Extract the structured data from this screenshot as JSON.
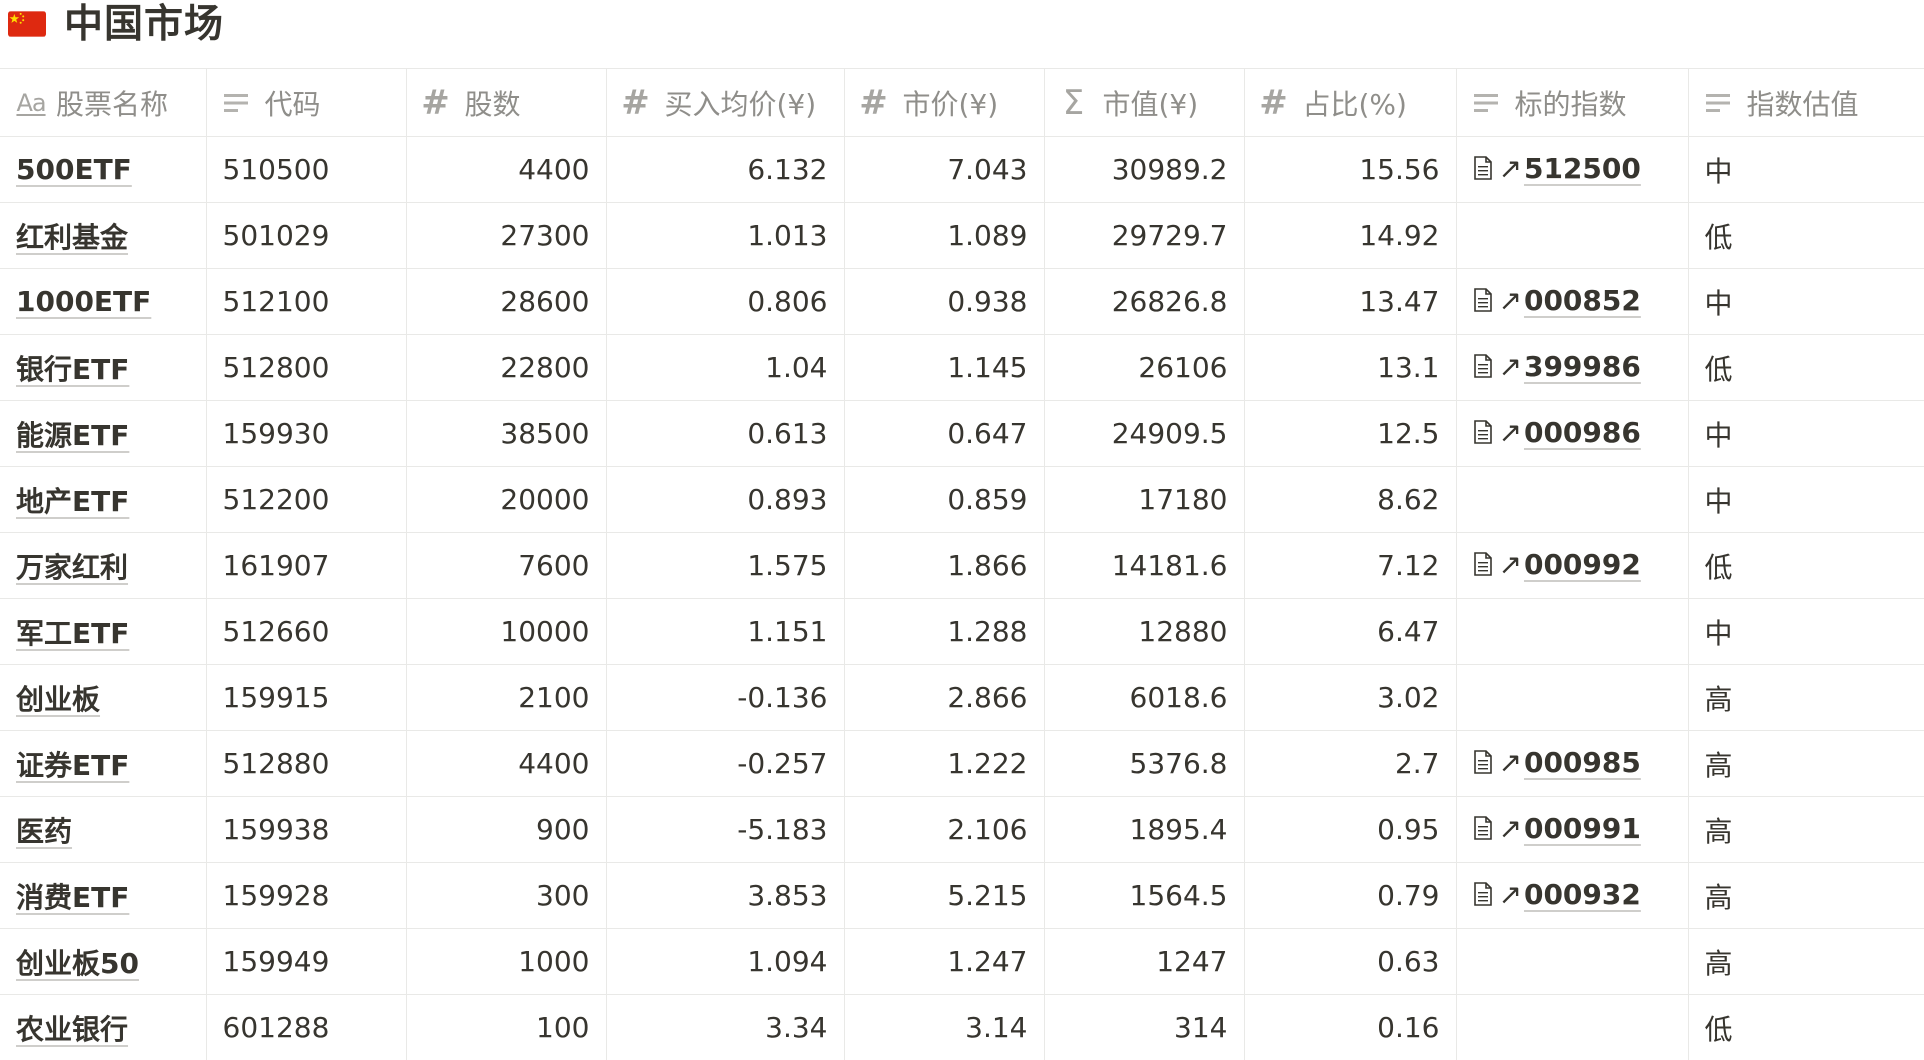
{
  "page": {
    "title": "中国市场",
    "flag_icon": "china-flag-icon",
    "colors": {
      "flag_red": "#de2910",
      "flag_yellow": "#ffde00",
      "text": "#37352f",
      "muted": "#8f8e8a",
      "border": "#e9e9e7"
    }
  },
  "columns": [
    {
      "key": "name",
      "label": "股票名称",
      "icon": "title-aa-icon"
    },
    {
      "key": "code",
      "label": "代码",
      "icon": "text-lines-icon"
    },
    {
      "key": "shares",
      "label": "股数",
      "icon": "number-hash-icon"
    },
    {
      "key": "cost",
      "label": "买入均价(¥)",
      "icon": "number-hash-icon"
    },
    {
      "key": "price",
      "label": "市价(¥)",
      "icon": "number-hash-icon"
    },
    {
      "key": "market_value",
      "label": "市值(¥)",
      "icon": "formula-sigma-icon"
    },
    {
      "key": "ratio",
      "label": "占比(%)",
      "icon": "number-hash-icon"
    },
    {
      "key": "index",
      "label": "标的指数",
      "icon": "text-lines-icon"
    },
    {
      "key": "valuation",
      "label": "指数估值",
      "icon": "text-lines-icon"
    }
  ],
  "rows": [
    {
      "name": "500ETF",
      "code": "510500",
      "shares": "4400",
      "cost": "6.132",
      "price": "7.043",
      "market_value": "30989.2",
      "ratio": "15.56",
      "index": "512500",
      "valuation": "中"
    },
    {
      "name": "红利基金",
      "code": "501029",
      "shares": "27300",
      "cost": "1.013",
      "price": "1.089",
      "market_value": "29729.7",
      "ratio": "14.92",
      "index": "",
      "valuation": "低"
    },
    {
      "name": "1000ETF",
      "code": "512100",
      "shares": "28600",
      "cost": "0.806",
      "price": "0.938",
      "market_value": "26826.8",
      "ratio": "13.47",
      "index": "000852",
      "valuation": "中"
    },
    {
      "name": "银行ETF",
      "code": "512800",
      "shares": "22800",
      "cost": "1.04",
      "price": "1.145",
      "market_value": "26106",
      "ratio": "13.1",
      "index": "399986",
      "valuation": "低"
    },
    {
      "name": "能源ETF",
      "code": "159930",
      "shares": "38500",
      "cost": "0.613",
      "price": "0.647",
      "market_value": "24909.5",
      "ratio": "12.5",
      "index": "000986",
      "valuation": "中"
    },
    {
      "name": "地产ETF",
      "code": "512200",
      "shares": "20000",
      "cost": "0.893",
      "price": "0.859",
      "market_value": "17180",
      "ratio": "8.62",
      "index": "",
      "valuation": "中"
    },
    {
      "name": "万家红利",
      "code": "161907",
      "shares": "7600",
      "cost": "1.575",
      "price": "1.866",
      "market_value": "14181.6",
      "ratio": "7.12",
      "index": "000992",
      "valuation": "低"
    },
    {
      "name": "军工ETF",
      "code": "512660",
      "shares": "10000",
      "cost": "1.151",
      "price": "1.288",
      "market_value": "12880",
      "ratio": "6.47",
      "index": "",
      "valuation": "中"
    },
    {
      "name": "创业板",
      "code": "159915",
      "shares": "2100",
      "cost": "-0.136",
      "price": "2.866",
      "market_value": "6018.6",
      "ratio": "3.02",
      "index": "",
      "valuation": "高"
    },
    {
      "name": "证券ETF",
      "code": "512880",
      "shares": "4400",
      "cost": "-0.257",
      "price": "1.222",
      "market_value": "5376.8",
      "ratio": "2.7",
      "index": "000985",
      "valuation": "高"
    },
    {
      "name": "医药",
      "code": "159938",
      "shares": "900",
      "cost": "-5.183",
      "price": "2.106",
      "market_value": "1895.4",
      "ratio": "0.95",
      "index": "000991",
      "valuation": "高"
    },
    {
      "name": "消费ETF",
      "code": "159928",
      "shares": "300",
      "cost": "3.853",
      "price": "5.215",
      "market_value": "1564.5",
      "ratio": "0.79",
      "index": "000932",
      "valuation": "高"
    },
    {
      "name": "创业板50",
      "code": "159949",
      "shares": "1000",
      "cost": "1.094",
      "price": "1.247",
      "market_value": "1247",
      "ratio": "0.63",
      "index": "",
      "valuation": "高"
    },
    {
      "name": "农业银行",
      "code": "601288",
      "shares": "100",
      "cost": "3.34",
      "price": "3.14",
      "market_value": "314",
      "ratio": "0.16",
      "index": "",
      "valuation": "低"
    }
  ]
}
